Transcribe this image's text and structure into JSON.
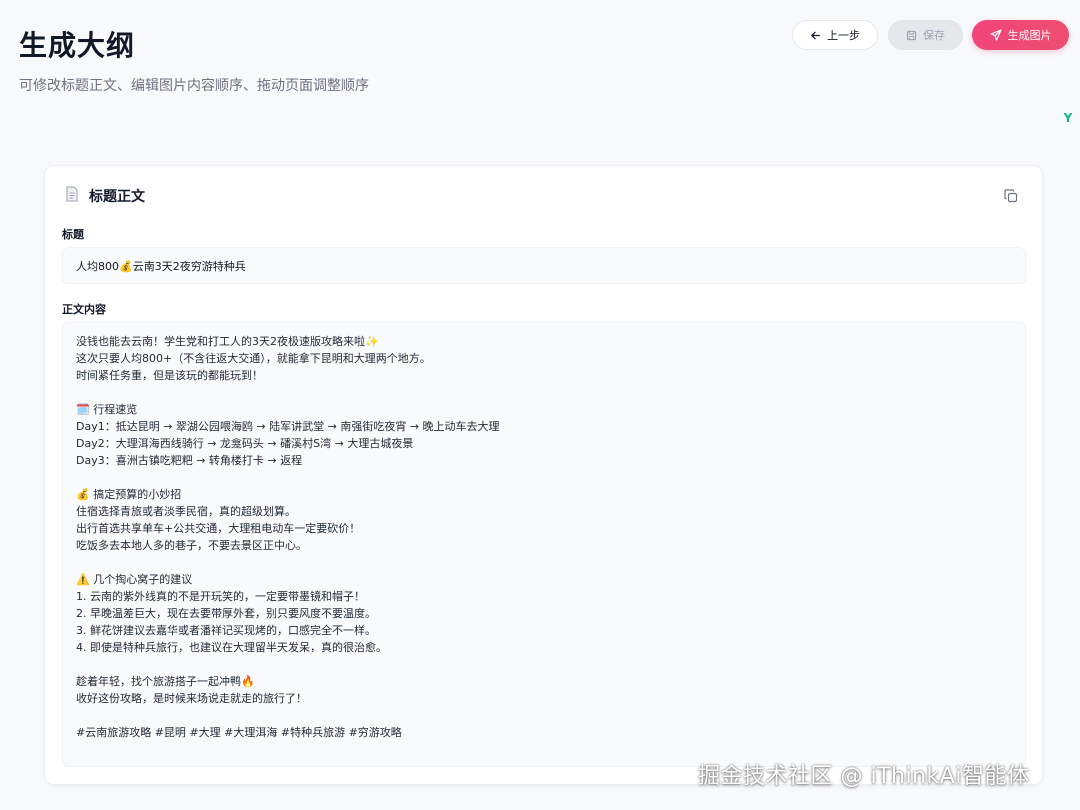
{
  "header": {
    "title": "生成大纲",
    "subtitle": "可修改标题正文、编辑图片内容顺序、拖动页面调整顺序"
  },
  "toolbar": {
    "back_label": "上一步",
    "save_label": "保存",
    "generate_label": "生成图片"
  },
  "badge": {
    "label": "Y"
  },
  "card": {
    "title": "标题正文",
    "title_field_label": "标题",
    "title_value": "人均800💰云南3天2夜穷游特种兵",
    "content_field_label": "正文内容",
    "content_lines": [
      "没钱也能去云南！学生党和打工人的3天2夜极速版攻略来啦✨",
      "这次只要人均800+（不含往返大交通），就能拿下昆明和大理两个地方。",
      "时间紧任务重，但是该玩的都能玩到！",
      "",
      "🗓️ 行程速览",
      "Day1：抵达昆明 → 翠湖公园喂海鸥 → 陆军讲武堂 → 南强街吃夜宵 → 晚上动车去大理",
      "Day2：大理洱海西线骑行 → 龙龛码头 → 磻溪村S湾 → 大理古城夜景",
      "Day3：喜洲古镇吃粑粑 → 转角楼打卡 → 返程",
      "",
      "💰 搞定预算的小妙招",
      "住宿选择青旅或者淡季民宿，真的超级划算。",
      "出行首选共享单车+公共交通，大理租电动车一定要砍价！",
      "吃饭多去本地人多的巷子，不要去景区正中心。",
      "",
      "⚠️ 几个掏心窝子的建议",
      "1. 云南的紫外线真的不是开玩笑的，一定要带墨镜和帽子！",
      "2. 早晚温差巨大，现在去要带厚外套，别只要风度不要温度。",
      "3. 鲜花饼建议去嘉华或者潘祥记买现烤的，口感完全不一样。",
      "4. 即使是特种兵旅行，也建议在大理留半天发呆，真的很治愈。",
      "",
      "趁着年轻，找个旅游搭子一起冲鸭🔥",
      "收好这份攻略，是时候来场说走就走的旅行了！",
      "",
      "#云南旅游攻略 #昆明 #大理 #大理洱海 #特种兵旅游 #穷游攻略"
    ]
  },
  "watermark": "掘金技术社区 @ iThinkAi智能体",
  "colors": {
    "accent": "#f0457a",
    "background": "#f8f9fb",
    "badge": "#10b981"
  },
  "icons": {
    "back": "arrow-left-icon",
    "save": "floppy-disk-icon",
    "generate": "send-icon",
    "card": "document-icon",
    "copy": "copy-icon"
  }
}
